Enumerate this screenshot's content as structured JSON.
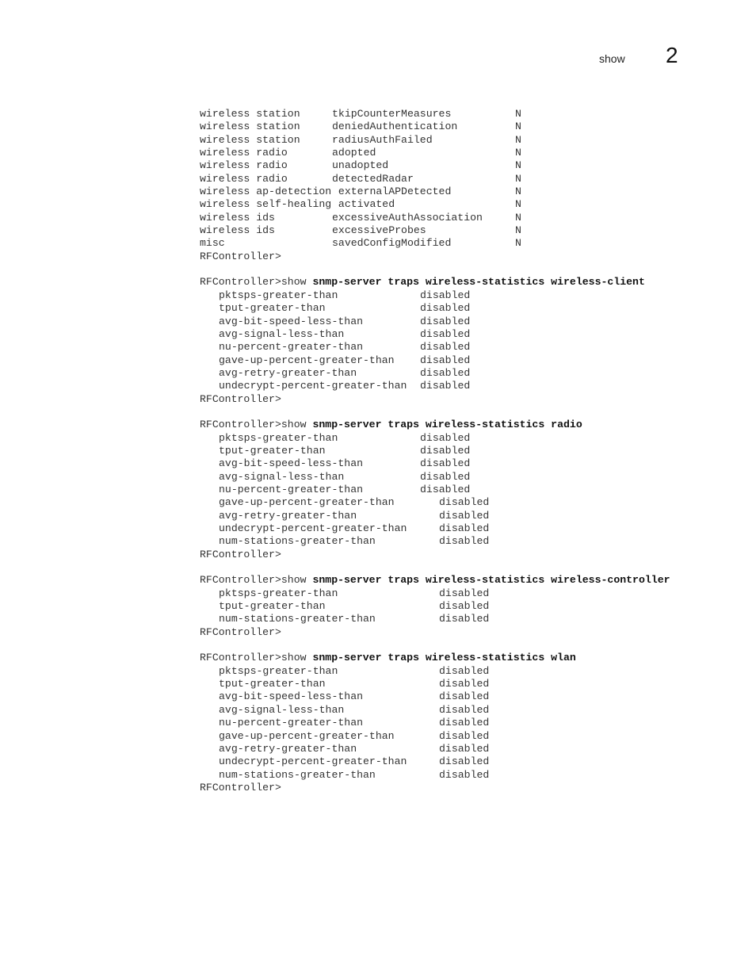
{
  "header": {
    "section": "show",
    "chapter": "2"
  },
  "trap_table": [
    {
      "type": "wireless station",
      "name": "tkipCounterMeasures",
      "enabled": "N"
    },
    {
      "type": "wireless station",
      "name": "deniedAuthentication",
      "enabled": "N"
    },
    {
      "type": "wireless station",
      "name": "radiusAuthFailed",
      "enabled": "N"
    },
    {
      "type": "wireless radio",
      "name": "adopted",
      "enabled": "N"
    },
    {
      "type": "wireless radio",
      "name": "unadopted",
      "enabled": "N"
    },
    {
      "type": "wireless radio",
      "name": "detectedRadar",
      "enabled": "N"
    },
    {
      "type": "wireless ap-detection",
      "name": " externalAPDetected",
      "enabled": "N"
    },
    {
      "type": "wireless self-healing",
      "name": " activated",
      "enabled": "N"
    },
    {
      "type": "wireless ids",
      "name": "excessiveAuthAssociation",
      "enabled": "N"
    },
    {
      "type": "wireless ids",
      "name": "excessiveProbes",
      "enabled": "N"
    },
    {
      "type": "misc",
      "name": "savedConfigModified",
      "enabled": "N"
    }
  ],
  "prompt": "RFController>",
  "blocks": [
    {
      "prefix": "RFController>show ",
      "command": "snmp-server traps wireless-statistics wireless-client",
      "rows": [
        {
          "key": "pktsps-greater-than",
          "value": "disabled",
          "w": 1
        },
        {
          "key": "tput-greater-than",
          "value": "disabled",
          "w": 1
        },
        {
          "key": "avg-bit-speed-less-than",
          "value": "disabled",
          "w": 1
        },
        {
          "key": "avg-signal-less-than",
          "value": "disabled",
          "w": 1
        },
        {
          "key": "nu-percent-greater-than",
          "value": "disabled",
          "w": 1
        },
        {
          "key": "gave-up-percent-greater-than",
          "value": "disabled",
          "w": 1
        },
        {
          "key": "avg-retry-greater-than",
          "value": "disabled",
          "w": 1
        },
        {
          "key": "undecrypt-percent-greater-than",
          "value": "disabled",
          "w": 1
        }
      ]
    },
    {
      "prefix": "RFController>show ",
      "command": "snmp-server traps wireless-statistics radio",
      "rows": [
        {
          "key": "pktsps-greater-than",
          "value": "disabled",
          "w": 1
        },
        {
          "key": "tput-greater-than",
          "value": "disabled",
          "w": 1
        },
        {
          "key": "avg-bit-speed-less-than",
          "value": "disabled",
          "w": 1
        },
        {
          "key": "avg-signal-less-than",
          "value": "disabled",
          "w": 1
        },
        {
          "key": "nu-percent-greater-than",
          "value": "disabled",
          "w": 1
        },
        {
          "key": "gave-up-percent-greater-than",
          "value": "disabled",
          "w": 2
        },
        {
          "key": "avg-retry-greater-than",
          "value": "disabled",
          "w": 2
        },
        {
          "key": "undecrypt-percent-greater-than",
          "value": "disabled",
          "w": 2
        },
        {
          "key": "num-stations-greater-than",
          "value": "disabled",
          "w": 2
        }
      ]
    },
    {
      "prefix": "RFController>show ",
      "command": "snmp-server traps wireless-statistics wireless-controller",
      "rows": [
        {
          "key": "pktsps-greater-than",
          "value": "disabled",
          "w": 2
        },
        {
          "key": "tput-greater-than",
          "value": "disabled",
          "w": 2
        },
        {
          "key": "num-stations-greater-than",
          "value": "disabled",
          "w": 2
        }
      ]
    },
    {
      "prefix": "RFController>show ",
      "command": "snmp-server traps wireless-statistics wlan",
      "rows": [
        {
          "key": "pktsps-greater-than",
          "value": "disabled",
          "w": 2
        },
        {
          "key": "tput-greater-than",
          "value": "disabled",
          "w": 2
        },
        {
          "key": "avg-bit-speed-less-than",
          "value": "disabled",
          "w": 2
        },
        {
          "key": "avg-signal-less-than",
          "value": "disabled",
          "w": 2
        },
        {
          "key": "nu-percent-greater-than",
          "value": "disabled",
          "w": 2
        },
        {
          "key": "gave-up-percent-greater-than",
          "value": "disabled",
          "w": 2
        },
        {
          "key": "avg-retry-greater-than",
          "value": "disabled",
          "w": 2
        },
        {
          "key": "undecrypt-percent-greater-than",
          "value": "disabled",
          "w": 2
        },
        {
          "key": "num-stations-greater-than",
          "value": "disabled",
          "w": 2
        }
      ]
    }
  ]
}
